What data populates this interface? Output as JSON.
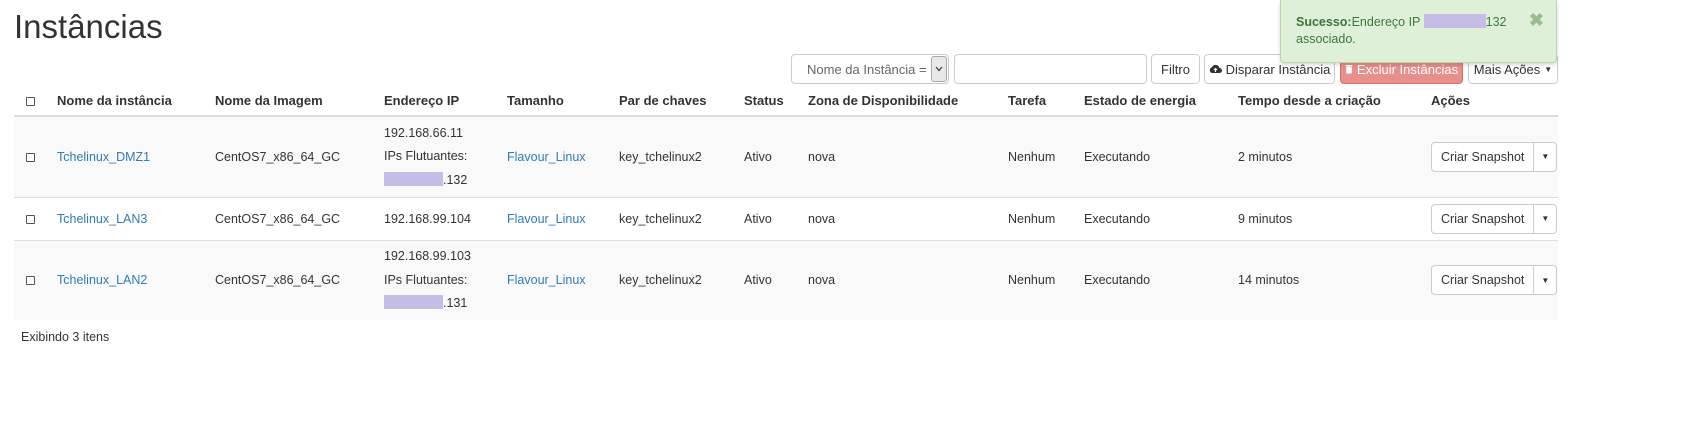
{
  "page": {
    "title": "Instâncias"
  },
  "toolbar": {
    "filter_select": "Nome da Instância =",
    "filter_input_value": "",
    "filter_button": "Filtro",
    "launch_button": "Disparar Instância",
    "delete_button": "Excluir Instâncias",
    "more_actions": "Mais Ações"
  },
  "toast": {
    "title": "Sucesso:",
    "message_prefix": "Endereço IP",
    "message_suffix": "132",
    "message_line2": "associado.",
    "close": "✖"
  },
  "table": {
    "headers": [
      "Nome da instância",
      "Nome da Imagem",
      "Endereço IP",
      "Tamanho",
      "Par de chaves",
      "Status",
      "Zona de Disponibilidade",
      "Tarefa",
      "Estado de energia",
      "Tempo desde a criação",
      "Ações"
    ],
    "rows": [
      {
        "name": "Tchelinux_DMZ1",
        "image": "CentOS7_x86_64_GC",
        "ip": "192.168.66.11",
        "floating_label": "IPs Flutuantes:",
        "floating_suffix": ".132",
        "size": "Flavour_Linux",
        "keypair": "key_tchelinux2",
        "status": "Ativo",
        "zone": "nova",
        "task": "Nenhum",
        "power": "Executando",
        "age": "2 minutos",
        "action": "Criar Snapshot"
      },
      {
        "name": "Tchelinux_LAN3",
        "image": "CentOS7_x86_64_GC",
        "ip": "192.168.99.104",
        "size": "Flavour_Linux",
        "keypair": "key_tchelinux2",
        "status": "Ativo",
        "zone": "nova",
        "task": "Nenhum",
        "power": "Executando",
        "age": "9 minutos",
        "action": "Criar Snapshot"
      },
      {
        "name": "Tchelinux_LAN2",
        "image": "CentOS7_x86_64_GC",
        "ip": "192.168.99.103",
        "floating_label": "IPs Flutuantes:",
        "floating_suffix": ".131",
        "size": "Flavour_Linux",
        "keypair": "key_tchelinux2",
        "status": "Ativo",
        "zone": "nova",
        "task": "Nenhum",
        "power": "Executando",
        "age": "14 minutos",
        "action": "Criar Snapshot"
      }
    ]
  },
  "footer": {
    "count_text": "Exibindo 3 itens"
  },
  "colors": {
    "link": "#337ab7",
    "success_bg": "#dff0d8",
    "success_text": "#3c763d",
    "danger": "#d9534f",
    "redaction": "#c5bde6"
  },
  "icons": {
    "launch": "cloud-upload-icon",
    "delete": "trash-icon",
    "close": "close-icon",
    "caret": "chevron-down-icon"
  }
}
